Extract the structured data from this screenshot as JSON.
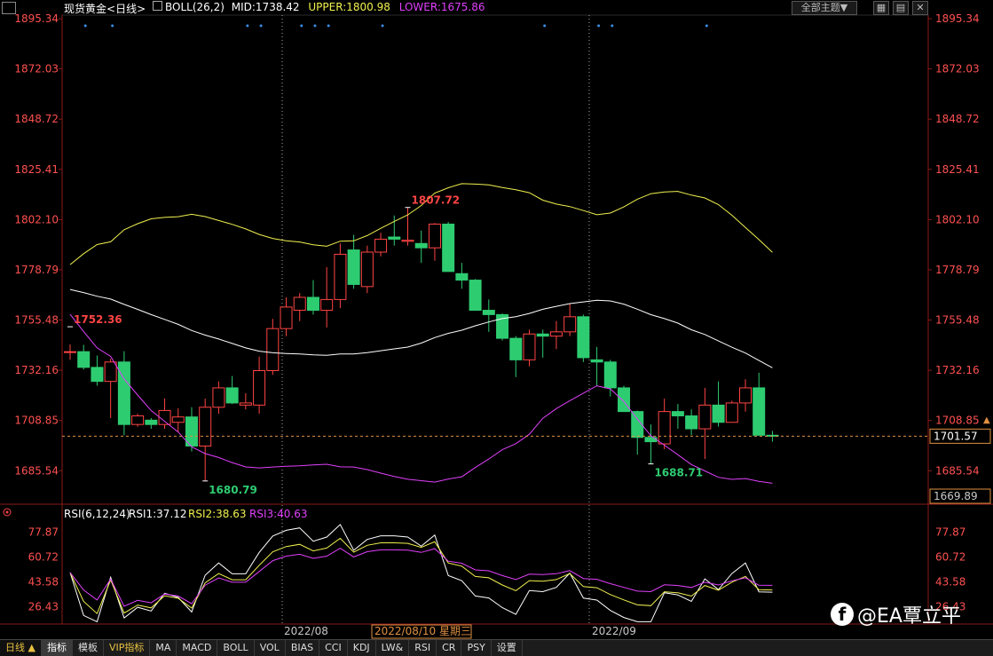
{
  "header": {
    "instrument": "现货黄金",
    "period": "<日线>",
    "boll": {
      "label": "BOLL(26,2)",
      "mid": "MID:1738.42",
      "upper": "UPPER:1800.98",
      "lower": "LOWER:1675.86"
    },
    "theme_button": "全部主题▼"
  },
  "chart_data": [
    {
      "type": "candlestick",
      "title": "现货黄金<日线>",
      "ylim": [
        1670,
        1897
      ],
      "y_ticks": [
        "1895.34",
        "1872.03",
        "1848.72",
        "1825.41",
        "1802.10",
        "1778.79",
        "1755.48",
        "1732.16",
        "1708.85",
        "1685.54"
      ],
      "x_labels": [
        "2022/08",
        "2022/09"
      ],
      "current_price": "1701.57",
      "low_marker": "1669.89",
      "annotations": [
        "1752.36",
        "1680.79",
        "1807.72",
        "1688.71"
      ],
      "candles": [
        [
          1740.5,
          1744.2,
          1737,
          1740.8
        ],
        [
          1740.8,
          1744,
          1732.5,
          1733.5
        ],
        [
          1733.5,
          1739,
          1725,
          1727
        ],
        [
          1727,
          1737.5,
          1710,
          1736
        ],
        [
          1736,
          1741,
          1702,
          1707
        ],
        [
          1707,
          1712,
          1706,
          1711
        ],
        [
          1709,
          1710,
          1705,
          1707
        ],
        [
          1707,
          1719,
          1705,
          1713.5
        ],
        [
          1708,
          1714.5,
          1703.5,
          1710.5
        ],
        [
          1710.5,
          1715,
          1694.5,
          1697
        ],
        [
          1697,
          1719,
          1680.8,
          1715
        ],
        [
          1715,
          1727,
          1712,
          1724
        ],
        [
          1724,
          1729.5,
          1716.5,
          1717
        ],
        [
          1716,
          1721.5,
          1714,
          1717
        ],
        [
          1716,
          1738.5,
          1712,
          1732
        ],
        [
          1732,
          1756,
          1730,
          1751.5
        ],
        [
          1751.5,
          1766,
          1748,
          1761.5
        ],
        [
          1760,
          1768,
          1755,
          1766
        ],
        [
          1766,
          1774,
          1758,
          1760
        ],
        [
          1760,
          1780,
          1752,
          1765
        ],
        [
          1765,
          1791,
          1761,
          1786
        ],
        [
          1788,
          1795,
          1770,
          1772
        ],
        [
          1771,
          1790,
          1768,
          1787
        ],
        [
          1787,
          1796,
          1785,
          1793
        ],
        [
          1794,
          1804,
          1790,
          1793
        ],
        [
          1792,
          1807.7,
          1790,
          1792.5
        ],
        [
          1791,
          1797,
          1782,
          1789
        ],
        [
          1789,
          1800.5,
          1783,
          1800
        ],
        [
          1800,
          1801,
          1778,
          1778
        ],
        [
          1777,
          1782,
          1770,
          1774
        ],
        [
          1774,
          1774.5,
          1760,
          1760
        ],
        [
          1760,
          1765,
          1750,
          1758
        ],
        [
          1758,
          1758.5,
          1746,
          1747
        ],
        [
          1747,
          1748,
          1729,
          1737
        ],
        [
          1737,
          1751,
          1734,
          1749
        ],
        [
          1749,
          1751,
          1738,
          1748
        ],
        [
          1748,
          1755,
          1742,
          1750
        ],
        [
          1750,
          1763,
          1748,
          1757
        ],
        [
          1757,
          1758,
          1736,
          1738
        ],
        [
          1737,
          1743,
          1725,
          1736
        ],
        [
          1736,
          1737,
          1720,
          1724
        ],
        [
          1724,
          1725,
          1713,
          1713
        ],
        [
          1713,
          1713.5,
          1693,
          1701
        ],
        [
          1701,
          1707,
          1688.7,
          1699
        ],
        [
          1698,
          1719,
          1695.5,
          1713
        ],
        [
          1713,
          1716.5,
          1705,
          1711
        ],
        [
          1711,
          1714,
          1702,
          1705
        ],
        [
          1705,
          1724,
          1691,
          1716
        ],
        [
          1716,
          1727,
          1706,
          1708
        ],
        [
          1708,
          1718,
          1708,
          1717
        ],
        [
          1717,
          1728,
          1713,
          1724
        ],
        [
          1724,
          1731,
          1705,
          1702
        ],
        [
          1702,
          1704,
          1699,
          1701.57
        ]
      ],
      "colors": {
        "up": "#ff4444",
        "down": "#2ecc71",
        "mid_line": "#ffffff",
        "upper_line": "#f0f050",
        "lower_line": "#e040fb"
      }
    },
    {
      "type": "line",
      "title": "RSI(6,12,24)",
      "ylim": [
        15,
        85
      ],
      "y_ticks": [
        "77.87",
        "60.72",
        "43.58",
        "26.43"
      ],
      "series": [
        {
          "name": "RSI1",
          "label": "RSI1:37.12",
          "color": "#ffffff"
        },
        {
          "name": "RSI2",
          "label": "RSI2:38.63",
          "color": "#f0f050"
        },
        {
          "name": "RSI3",
          "label": "RSI3:40.63",
          "color": "#e040fb"
        }
      ]
    }
  ],
  "x_axis": {
    "month1": "2022/08",
    "crosshair": "2022/08/10 星期三",
    "month2": "2022/09"
  },
  "bottom_tabs": {
    "period_label": "日线 ▲",
    "items": [
      "指标",
      "模板",
      "VIP指标",
      "MA",
      "MACD",
      "BOLL",
      "VOL",
      "BIAS",
      "CCI",
      "KDJ",
      "LW&",
      "RSI",
      "CR",
      "PSY",
      "设置"
    ]
  },
  "watermark": "@EA覃立平"
}
